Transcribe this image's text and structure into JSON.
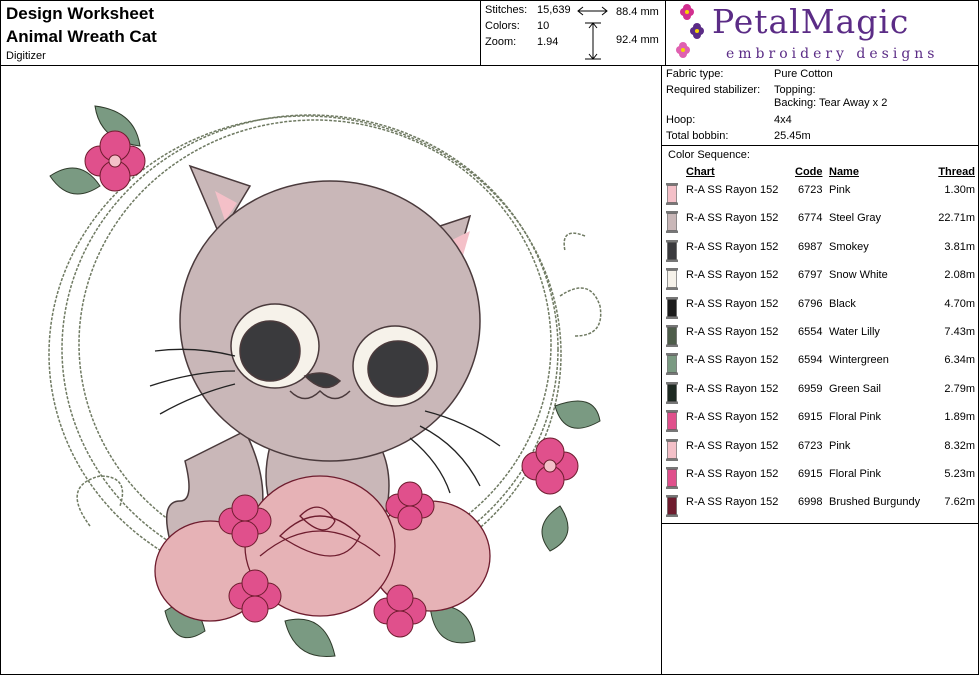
{
  "header": {
    "title": "Design Worksheet",
    "design_name": "Animal Wreath Cat",
    "subtitle": "Digitizer"
  },
  "stats": {
    "stitches_label": "Stitches:",
    "stitches": "15,639",
    "colors_label": "Colors:",
    "colors": "10",
    "zoom_label": "Zoom:",
    "zoom": "1.94",
    "width": "88.4 mm",
    "height": "92.4 mm"
  },
  "logo": {
    "brand": "PetalMagic",
    "tagline": "embroidery designs"
  },
  "info": {
    "fabric_label": "Fabric type:",
    "fabric": "Pure Cotton",
    "stabilizer_label": "Required stabilizer:",
    "stabilizer_top": "Topping:",
    "stabilizer_back": "Backing: Tear Away x 2",
    "hoop_label": "Hoop:",
    "hoop": "4x4",
    "bobbin_label": "Total bobbin:",
    "bobbin": "25.45m"
  },
  "sequence": {
    "title": "Color Sequence:",
    "headers": {
      "chart": "Chart",
      "code": "Code",
      "name": "Name",
      "thread": "Thread"
    },
    "rows": [
      {
        "chart": "R-A SS Rayon 152",
        "code": "6723",
        "name": "Pink",
        "thread": "1.30m",
        "color": "#f4c0c8"
      },
      {
        "chart": "R-A SS Rayon 152",
        "code": "6774",
        "name": "Steel Gray",
        "thread": "22.71m",
        "color": "#c9b7b8"
      },
      {
        "chart": "R-A SS Rayon 152",
        "code": "6987",
        "name": "Smokey",
        "thread": "3.81m",
        "color": "#3a3a3d"
      },
      {
        "chart": "R-A SS Rayon 152",
        "code": "6797",
        "name": "Snow White",
        "thread": "2.08m",
        "color": "#f6f2ea"
      },
      {
        "chart": "R-A SS Rayon 152",
        "code": "6796",
        "name": "Black",
        "thread": "4.70m",
        "color": "#1c1c1c"
      },
      {
        "chart": "R-A SS Rayon 152",
        "code": "6554",
        "name": "Water Lilly",
        "thread": "7.43m",
        "color": "#4e5d4a"
      },
      {
        "chart": "R-A SS Rayon 152",
        "code": "6594",
        "name": "Wintergreen",
        "thread": "6.34m",
        "color": "#7a9a82"
      },
      {
        "chart": "R-A SS Rayon 152",
        "code": "6959",
        "name": "Green Sail",
        "thread": "2.79m",
        "color": "#1e2a22"
      },
      {
        "chart": "R-A SS Rayon 152",
        "code": "6915",
        "name": "Floral Pink",
        "thread": "1.89m",
        "color": "#e0508c"
      },
      {
        "chart": "R-A SS Rayon 152",
        "code": "6723",
        "name": "Pink",
        "thread": "8.32m",
        "color": "#f4c0c8"
      },
      {
        "chart": "R-A SS Rayon 152",
        "code": "6915",
        "name": "Floral Pink",
        "thread": "5.23m",
        "color": "#e0508c"
      },
      {
        "chart": "R-A SS Rayon 152",
        "code": "6998",
        "name": "Brushed Burgundy",
        "thread": "7.62m",
        "color": "#6e1c2e"
      }
    ]
  }
}
